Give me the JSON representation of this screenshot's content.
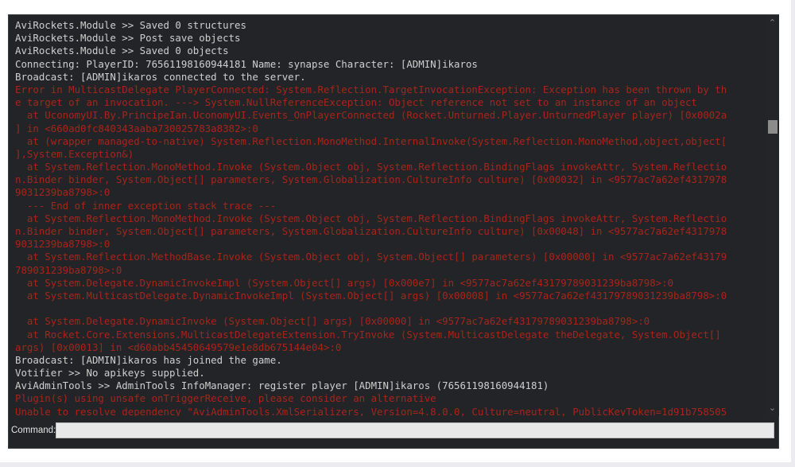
{
  "console": {
    "lines": [
      {
        "text": "AviRockets.Module >> Saved 0 structures",
        "level": "info"
      },
      {
        "text": "AviRockets.Module >> Post save objects",
        "level": "info"
      },
      {
        "text": "AviRockets.Module >> Saved 0 objects",
        "level": "info"
      },
      {
        "text": "Connecting: PlayerID: 76561198160944181 Name: synapse Character: [ADMIN]ikaros",
        "level": "info"
      },
      {
        "text": "Broadcast: [ADMIN]ikaros connected to the server.",
        "level": "info"
      },
      {
        "text": "Error in MulticastDelegate PlayerConnected: System.Reflection.TargetInvocationException: Exception has been thrown by th",
        "level": "error"
      },
      {
        "text": "e target of an invocation. ---> System.NullReferenceException: Object reference not set to an instance of an object",
        "level": "error"
      },
      {
        "text": "  at UconomyUI.By.PrincipeIan.UconomyUI.Events_OnPlayerConnected (Rocket.Unturned.Player.UnturnedPlayer player) [0x0002a",
        "level": "error"
      },
      {
        "text": "] in <660ad0fc840343aaba730025783a8382>:0",
        "level": "error"
      },
      {
        "text": "  at (wrapper managed-to-native) System.Reflection.MonoMethod.InternalInvoke(System.Reflection.MonoMethod,object,object[",
        "level": "error"
      },
      {
        "text": "],System.Exception&)",
        "level": "error"
      },
      {
        "text": "  at System.Reflection.MonoMethod.Invoke (System.Object obj, System.Reflection.BindingFlags invokeAttr, System.Reflectio",
        "level": "error"
      },
      {
        "text": "n.Binder binder, System.Object[] parameters, System.Globalization.CultureInfo culture) [0x00032] in <9577ac7a62ef4317978",
        "level": "error"
      },
      {
        "text": "9031239ba8798>:0",
        "level": "error"
      },
      {
        "text": "  --- End of inner exception stack trace ---",
        "level": "error"
      },
      {
        "text": "  at System.Reflection.MonoMethod.Invoke (System.Object obj, System.Reflection.BindingFlags invokeAttr, System.Reflectio",
        "level": "error"
      },
      {
        "text": "n.Binder binder, System.Object[] parameters, System.Globalization.CultureInfo culture) [0x00048] in <9577ac7a62ef4317978",
        "level": "error"
      },
      {
        "text": "9031239ba8798>:0",
        "level": "error"
      },
      {
        "text": "  at System.Reflection.MethodBase.Invoke (System.Object obj, System.Object[] parameters) [0x00000] in <9577ac7a62ef43179",
        "level": "error"
      },
      {
        "text": "789031239ba8798>:0",
        "level": "error"
      },
      {
        "text": "  at System.Delegate.DynamicInvokeImpl (System.Object[] args) [0x000e7] in <9577ac7a62ef43179789031239ba8798>:0",
        "level": "error"
      },
      {
        "text": "  at System.MulticastDelegate.DynamicInvokeImpl (System.Object[] args) [0x00008] in <9577ac7a62ef43179789031239ba8798>:0",
        "level": "error"
      },
      {
        "text": "",
        "level": "error"
      },
      {
        "text": "  at System.Delegate.DynamicInvoke (System.Object[] args) [0x00000] in <9577ac7a62ef43179789031239ba8798>:0",
        "level": "error"
      },
      {
        "text": "  at Rocket.Core.Extensions.MulticastDelegateExtension.TryInvoke (System.MulticastDelegate theDelegate, System.Object[]",
        "level": "error"
      },
      {
        "text": "args) [0x00013] in <d60abb45450649579e1e8db675144e04>:0",
        "level": "error"
      },
      {
        "text": "Broadcast: [ADMIN]ikaros has joined the game.",
        "level": "info"
      },
      {
        "text": "Votifier >> No apikeys supplied.",
        "level": "info"
      },
      {
        "text": "AviAdminTools >> AdminTools InfoManager: register player [ADMIN]ikaros (76561198160944181)",
        "level": "info"
      },
      {
        "text": "Plugin(s) using unsafe onTriggerReceive, please consider an alternative",
        "level": "error"
      },
      {
        "text": "Unable to resolve dependency \"AviAdminTools.XmlSerializers, Version=4.8.0.0, Culture=neutral, PublicKeyToken=1d91b758505",
        "level": "error"
      }
    ]
  },
  "scrollbar": {
    "up_icon": "chevron-up-icon",
    "down_icon": "chevron-down-icon"
  },
  "command": {
    "label": "Command:",
    "value": "",
    "placeholder": ""
  },
  "colors": {
    "background": "#222427",
    "info_text": "#cfcfcf",
    "error_text": "#a8241a",
    "input_bg": "#e8e8e8"
  }
}
